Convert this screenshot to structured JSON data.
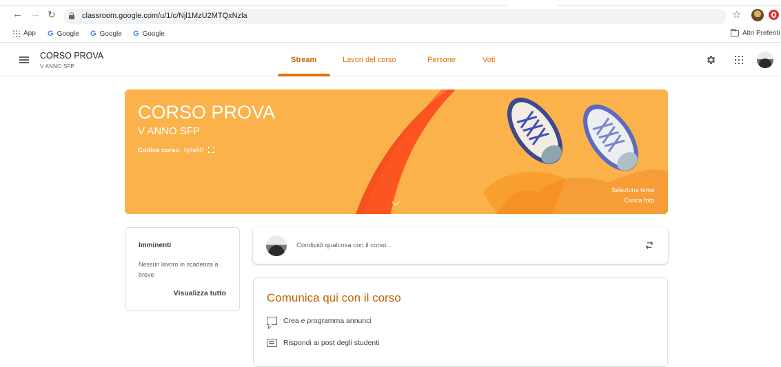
{
  "browser": {
    "url": "classroom.google.com/u/1/c/Njl1MzU2MTQxNzla",
    "bookmarks": [
      {
        "label": "App"
      },
      {
        "label": "Google"
      },
      {
        "label": "Google"
      },
      {
        "label": "Google"
      }
    ],
    "other_bookmarks": "Altri Preferiti"
  },
  "header": {
    "course_title": "CORSO PROVA",
    "course_section": "V ANNO SFP",
    "tabs": [
      {
        "label": "Stream",
        "active": true
      },
      {
        "label": "Lavori del corso",
        "active": false
      },
      {
        "label": "Persone",
        "active": false
      },
      {
        "label": "Voti",
        "active": false
      }
    ]
  },
  "banner": {
    "title": "CORSO PROVA",
    "section": "V ANNO SFP",
    "code_label": "Codice corso",
    "code_value": "hj4ef4f",
    "select_theme": "Seleziona tema",
    "upload_photo": "Carica foto",
    "color": "#fbb24a"
  },
  "upcoming": {
    "title": "Imminenti",
    "text": "Nessun lavoro in scadenza a breve",
    "link": "Visualizza tutto"
  },
  "share": {
    "placeholder": "Condividi qualcosa con il corso..."
  },
  "communicate": {
    "title": "Comunica qui con il corso",
    "items": [
      {
        "label": "Crea e programma annunci",
        "icon": "announcement-icon"
      },
      {
        "label": "Rispondi ai post degli studenti",
        "icon": "reply-icon"
      }
    ]
  },
  "colors": {
    "accent": "#e37400",
    "accent_dark": "#c26401"
  }
}
